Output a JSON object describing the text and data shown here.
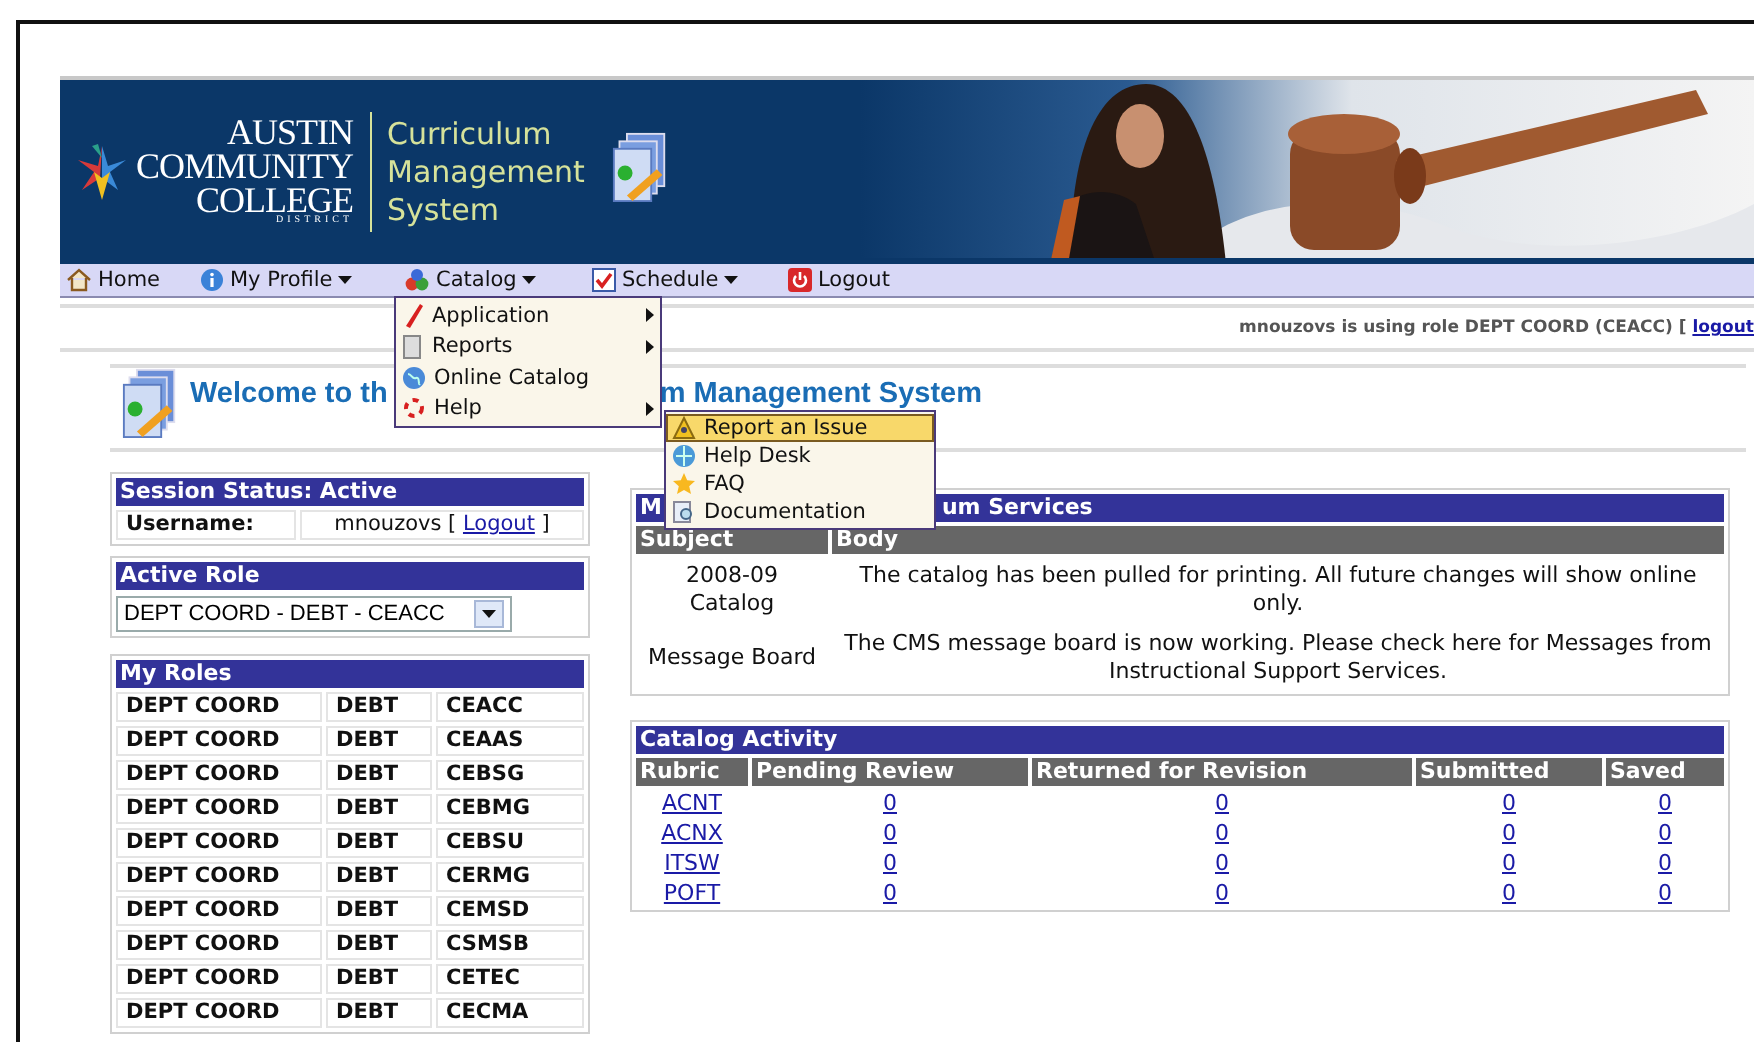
{
  "header": {
    "logo_lines": [
      "AUSTIN",
      "COMMUNITY",
      "COLLEGE",
      "DISTRICT"
    ],
    "app_title_lines": [
      "Curriculum",
      "Management",
      "System"
    ],
    "photo": {
      "kind": "picture"
    }
  },
  "menubar": [
    {
      "label": "Home",
      "dropdown": false
    },
    {
      "label": "My Profile",
      "dropdown": true
    },
    {
      "label": "Catalog",
      "dropdown": true
    },
    {
      "label": "Schedule",
      "dropdown": true
    },
    {
      "label": "Logout",
      "dropdown": false
    }
  ],
  "catalog_menu": [
    {
      "label": "Application",
      "submenu": true
    },
    {
      "label": "Reports",
      "submenu": true
    },
    {
      "label": "Online Catalog",
      "submenu": false
    },
    {
      "label": "Help",
      "submenu": true
    }
  ],
  "help_submenu": [
    {
      "label": "Report an Issue",
      "highlighted": true
    },
    {
      "label": "Help Desk",
      "highlighted": false
    },
    {
      "label": "FAQ",
      "highlighted": false
    },
    {
      "label": "Documentation",
      "highlighted": false
    }
  ],
  "user_bar": {
    "text": "mnouzovs is using role DEPT COORD (CEACC) [",
    "link": "logout"
  },
  "welcome": {
    "title_start": "Welcome to th",
    "title_end": "m Management System"
  },
  "session": {
    "title": "Session Status: Active",
    "label": "Username:",
    "value_before": "mnouzovs [",
    "link": "Logout",
    "value_after": "]"
  },
  "active_role": {
    "title": "Active Role",
    "value": "DEPT COORD - DEBT - CEACC"
  },
  "my_roles": {
    "title": "My Roles",
    "rows": [
      [
        "DEPT COORD",
        "DEBT",
        "CEACC"
      ],
      [
        "DEPT COORD",
        "DEBT",
        "CEAAS"
      ],
      [
        "DEPT COORD",
        "DEBT",
        "CEBSG"
      ],
      [
        "DEPT COORD",
        "DEBT",
        "CEBMG"
      ],
      [
        "DEPT COORD",
        "DEBT",
        "CEBSU"
      ],
      [
        "DEPT COORD",
        "DEBT",
        "CERMG"
      ],
      [
        "DEPT COORD",
        "DEBT",
        "CEMSD"
      ],
      [
        "DEPT COORD",
        "DEBT",
        "CSMSB"
      ],
      [
        "DEPT COORD",
        "DEBT",
        "CETEC"
      ],
      [
        "DEPT COORD",
        "DEBT",
        "CECMA"
      ]
    ]
  },
  "messages": {
    "title_start": "M",
    "title_end": "um Services",
    "columns": [
      "Subject",
      "Body"
    ],
    "rows": [
      {
        "subject": "2008-09 Catalog",
        "body": "The catalog has been pulled for printing. All future changes will show online only."
      },
      {
        "subject": "Message Board",
        "body": "The CMS message board is now working. Please check here for Messages from Instructional Support Services."
      }
    ]
  },
  "catalog_activity": {
    "title": "Catalog Activity",
    "columns": [
      "Rubric",
      "Pending Review",
      "Returned for Revision",
      "Submitted",
      "Saved"
    ],
    "rows": [
      {
        "rubric": "ACNT",
        "counts": [
          "0",
          "0",
          "0",
          "0"
        ]
      },
      {
        "rubric": "ACNX",
        "counts": [
          "0",
          "0",
          "0",
          "0"
        ]
      },
      {
        "rubric": "ITSW",
        "counts": [
          "0",
          "0",
          "0",
          "0"
        ]
      },
      {
        "rubric": "POFT",
        "counts": [
          "0",
          "0",
          "0",
          "0"
        ]
      }
    ]
  }
}
